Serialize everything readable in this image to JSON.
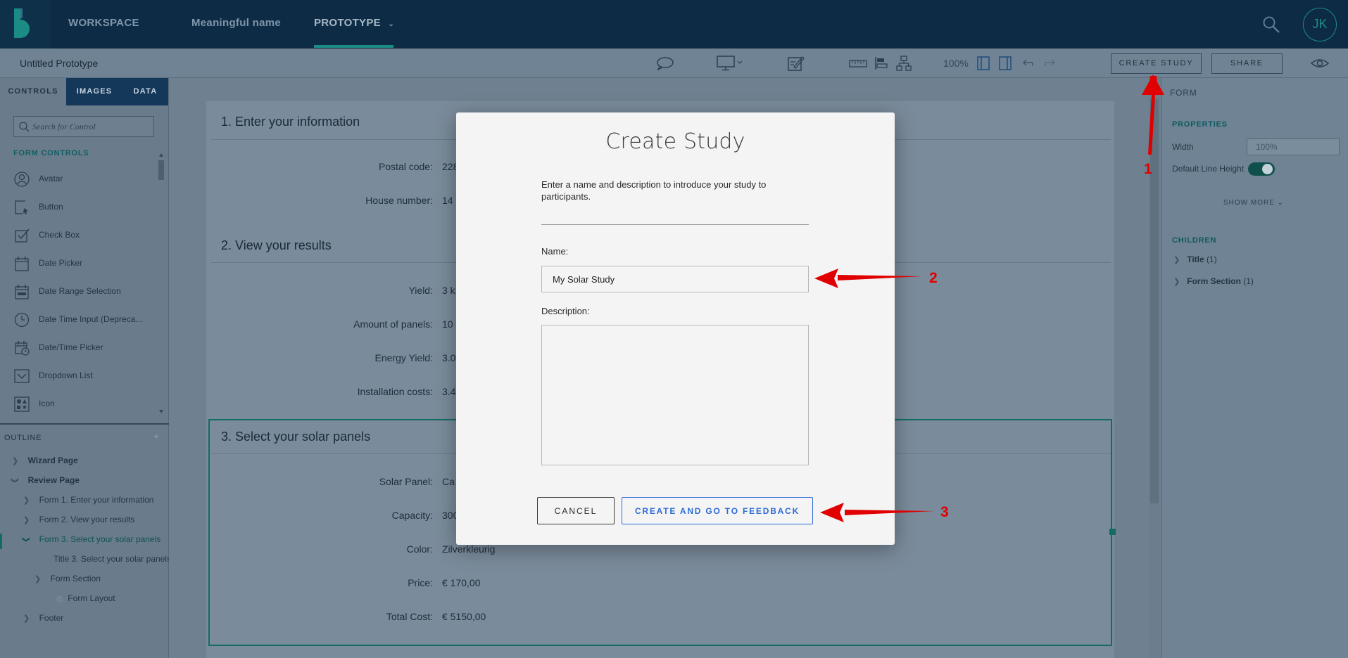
{
  "topbar": {
    "workspace": "WORKSPACE",
    "project": "Meaningful name",
    "prototype": "PROTOTYPE",
    "avatar": "JK"
  },
  "toolbar": {
    "doc_title": "Untitled Prototype",
    "zoom": "100%",
    "create_study": "CREATE STUDY",
    "share": "SHARE"
  },
  "left_panel": {
    "tabs": [
      "CONTROLS",
      "IMAGES",
      "DATA"
    ],
    "search_placeholder": "Search for Control",
    "section_label": "FORM CONTROLS",
    "controls": [
      {
        "label": "Avatar",
        "icon": "avatar-icon"
      },
      {
        "label": "Button",
        "icon": "button-icon"
      },
      {
        "label": "Check Box",
        "icon": "checkbox-icon"
      },
      {
        "label": "Date Picker",
        "icon": "calendar-icon"
      },
      {
        "label": "Date Range Selection",
        "icon": "calendar-range-icon"
      },
      {
        "label": "Date Time Input (Depreca...",
        "icon": "clock-icon"
      },
      {
        "label": "Date/Time Picker",
        "icon": "calendar-clock-icon"
      },
      {
        "label": "Dropdown List",
        "icon": "dropdown-icon"
      },
      {
        "label": "Icon",
        "icon": "shapes-icon"
      }
    ],
    "outline_label": "OUTLINE",
    "outline": [
      {
        "label": "Wizard Page"
      },
      {
        "label": "Review Page"
      },
      {
        "label": "Form 1. Enter your information"
      },
      {
        "label": "Form 2. View your results"
      },
      {
        "label": "Form 3. Select your solar panels"
      },
      {
        "label": "Title 3. Select your solar panels"
      },
      {
        "label": "Form Section"
      },
      {
        "label": "Form Layout"
      },
      {
        "label": "Footer"
      }
    ]
  },
  "canvas": {
    "sections": [
      {
        "title": "1. Enter your information",
        "fields": [
          {
            "label": "Postal code:",
            "value": "228"
          },
          {
            "label": "House number:",
            "value": "14"
          }
        ]
      },
      {
        "title": "2. View your results",
        "fields": [
          {
            "label": "Yield:",
            "value": "3 k"
          },
          {
            "label": "Amount of panels:",
            "value": "10"
          },
          {
            "label": "Energy Yield:",
            "value": "3.0"
          },
          {
            "label": "Installation costs:",
            "value": "3.4"
          }
        ]
      },
      {
        "title": "3. Select your solar panels",
        "fields": [
          {
            "label": "Solar Panel:",
            "value": "Ca"
          },
          {
            "label": "Capacity:",
            "value": "300"
          },
          {
            "label": "Color:",
            "value": "Zilverkleurig"
          },
          {
            "label": "Price:",
            "value": "€ 170,00"
          },
          {
            "label": "Total Cost:",
            "value": "€ 5150,00"
          }
        ]
      }
    ]
  },
  "right_panel": {
    "title": "FORM",
    "properties_label": "PROPERTIES",
    "width_label": "Width",
    "width_value": "100%",
    "line_height_label": "Default Line Height",
    "line_height_on": true,
    "show_more": "SHOW MORE",
    "children_label": "CHILDREN",
    "children": [
      {
        "label": "Title",
        "count": "(1)"
      },
      {
        "label": "Form Section",
        "count": "(1)"
      }
    ]
  },
  "modal": {
    "title": "Create Study",
    "intro": "Enter a name and description to introduce your study to participants.",
    "name_label": "Name:",
    "name_value": "My Solar Study",
    "description_label": "Description:",
    "description_value": "",
    "cancel": "CANCEL",
    "create": "CREATE AND GO TO FEEDBACK"
  },
  "annotations": [
    "1",
    "2",
    "3"
  ],
  "colors": {
    "accent": "#1b8c83",
    "annotation": "#e00000",
    "primary_button": "#2e6bd6",
    "topbar": "#0d2b45"
  }
}
